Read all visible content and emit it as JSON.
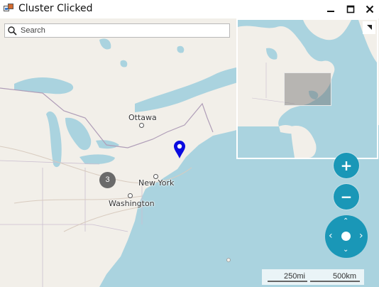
{
  "window": {
    "title": "Cluster Clicked",
    "controls": {
      "minimize": "minimize-icon",
      "maximize": "maximize-icon",
      "close": "close-icon"
    }
  },
  "search": {
    "placeholder": "Search",
    "value": ""
  },
  "map": {
    "cities": [
      {
        "name": "Ottawa"
      },
      {
        "name": "New York"
      },
      {
        "name": "Washington"
      }
    ],
    "cluster": {
      "count": "3"
    },
    "pin": {
      "icon": "map-pin-icon",
      "color": "#0a0ae0"
    }
  },
  "controls": {
    "zoom_in": "+",
    "zoom_out": "−",
    "pan": {
      "up": "⌃",
      "down": "⌄",
      "left": "‹",
      "right": "›"
    }
  },
  "scale": {
    "imperial": "250mi",
    "metric": "500km"
  },
  "colors": {
    "water": "#aad3df",
    "land": "#f2efe9",
    "accent": "#1a97b7",
    "cluster": "#6a6a6a"
  }
}
